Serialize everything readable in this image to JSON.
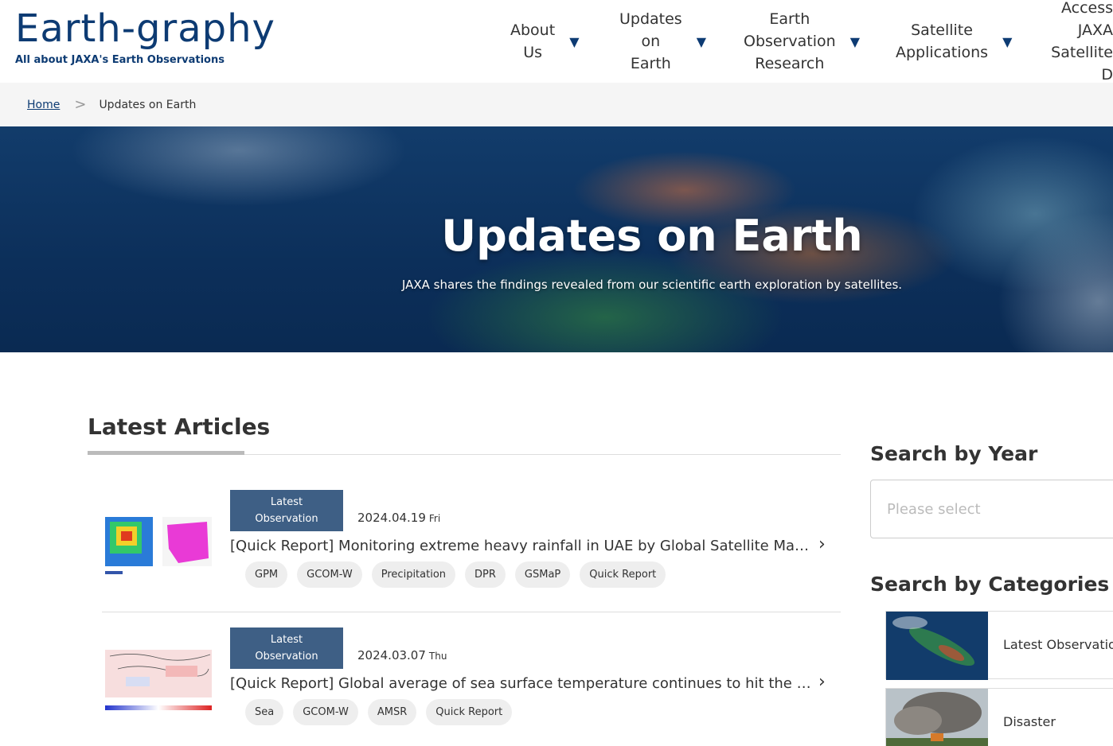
{
  "logo": {
    "title": "Earth-graphy",
    "subtitle": "All about JAXA's Earth Observations"
  },
  "nav": [
    {
      "label": "About\nUs",
      "arrow": "▼"
    },
    {
      "label": "Updates\non\nEarth",
      "arrow": "▼"
    },
    {
      "label": "Earth\nObservation\nResearch",
      "arrow": "▼"
    },
    {
      "label": "Satellite\nApplications",
      "arrow": "▼"
    },
    {
      "label": "Access\nJAXA\nSatellite D",
      "arrow": ""
    }
  ],
  "breadcrumb": {
    "home": "Home",
    "separator": ">",
    "current": "Updates on Earth"
  },
  "hero": {
    "title": "Updates on Earth",
    "subtitle": "JAXA shares the findings revealed from our scientific earth exploration by satellites."
  },
  "main": {
    "section_title": "Latest Articles",
    "articles": [
      {
        "badge": "Latest\nObservation",
        "date": "2024.04.19",
        "dow": "Fri",
        "title": "[Quick Report] Monitoring extreme heavy rainfall in UAE by Global Satellite Mapping of Precipitation",
        "tags": [
          "GPM",
          "GCOM-W",
          "Precipitation",
          "DPR",
          "GSMaP",
          "Quick Report"
        ],
        "chevron": "›"
      },
      {
        "badge": "Latest\nObservation",
        "date": "2024.03.07",
        "dow": "Thu",
        "title": "[Quick Report] Global average of sea surface temperature continues to hit the record high",
        "tags": [
          "Sea",
          "GCOM-W",
          "AMSR",
          "Quick Report"
        ],
        "chevron": "›"
      }
    ]
  },
  "sidebar": {
    "year_title": "Search by Year",
    "year_placeholder": "Please select",
    "categories_title": "Search by Categories",
    "categories": [
      {
        "label": "Latest Observation"
      },
      {
        "label": "Disaster"
      }
    ]
  },
  "colors": {
    "brand": "#0d3b73",
    "badge": "#3e5f85",
    "tag_bg": "#eeeeee",
    "breadcrumb_bg": "#f5f5f5"
  }
}
